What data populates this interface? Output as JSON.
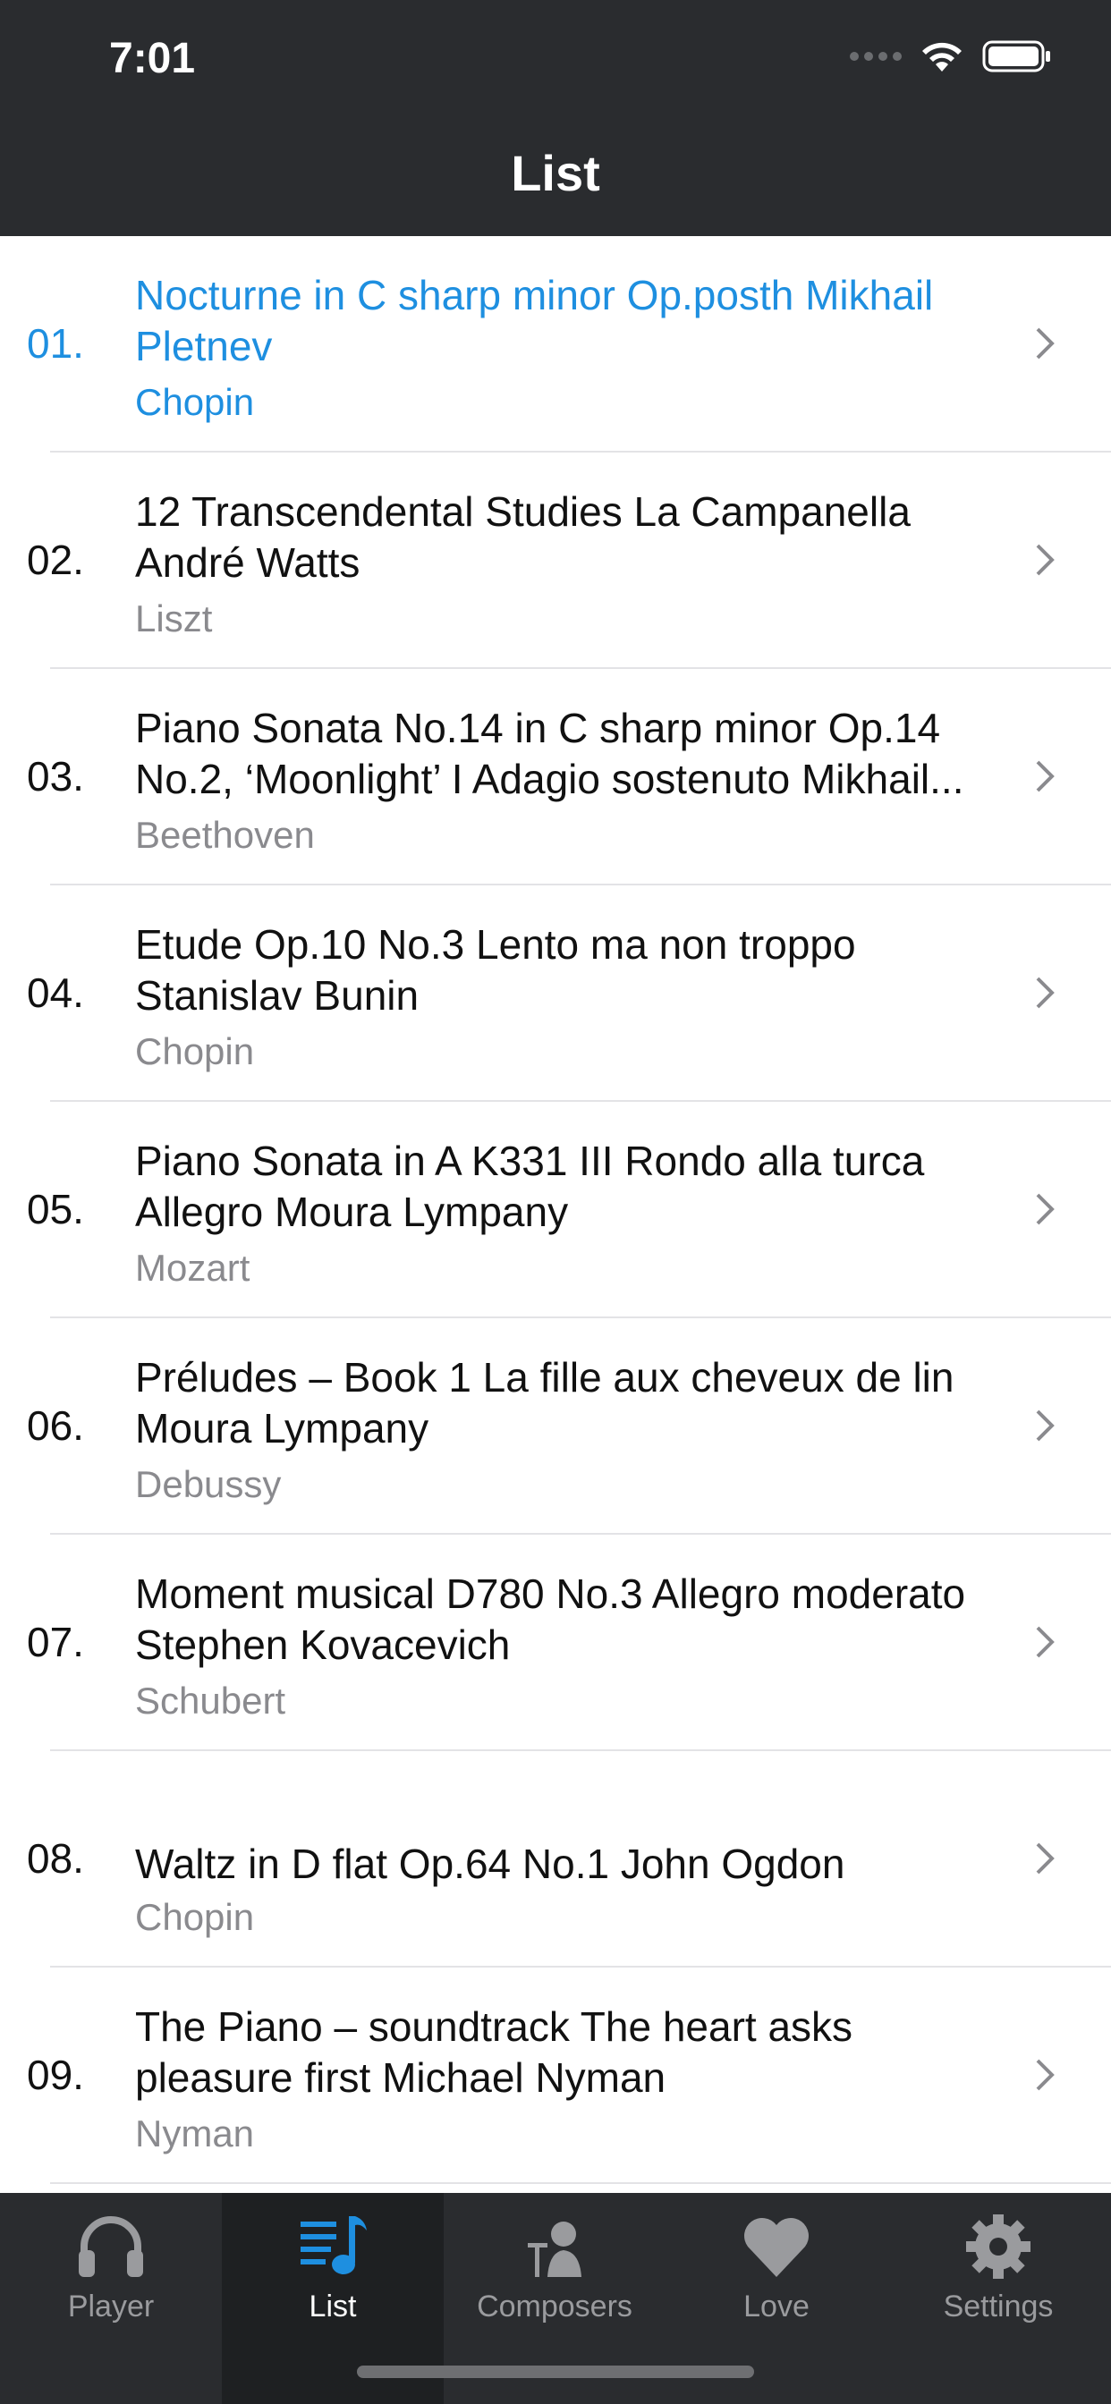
{
  "status": {
    "time": "7:01"
  },
  "header": {
    "title": "List"
  },
  "tracks": [
    {
      "number": "01.",
      "title": "Nocturne in C sharp minor Op.posth Mikhail Pletnev",
      "composer": "Chopin"
    },
    {
      "number": "02.",
      "title": "12 Transcendental Studies La Campanella André Watts",
      "composer": "Liszt"
    },
    {
      "number": "03.",
      "title": "Piano Sonata No.14 in C sharp minor Op.14 No.2, ‘Moonlight’ I Adagio sostenuto Mikhail...",
      "composer": "Beethoven"
    },
    {
      "number": "04.",
      "title": "Etude Op.10 No.3 Lento ma non troppo Stanislav Bunin",
      "composer": "Chopin"
    },
    {
      "number": "05.",
      "title": "Piano Sonata in A K331 III Rondo alla turca Allegro Moura Lympany",
      "composer": "Mozart"
    },
    {
      "number": "06.",
      "title": "Préludes – Book 1 La fille aux cheveux de lin Moura Lympany",
      "composer": "Debussy"
    },
    {
      "number": "07.",
      "title": "Moment musical D780 No.3 Allegro moderato Stephen Kovacevich",
      "composer": "Schubert"
    },
    {
      "number": "08.",
      "title": "Waltz in D flat Op.64 No.1 John Ogdon",
      "composer": "Chopin"
    },
    {
      "number": "09.",
      "title": "The Piano – soundtrack The heart asks pleasure first Michael Nyman",
      "composer": "Nyman"
    }
  ],
  "tabs": [
    {
      "label": "Player",
      "icon": "headphones-icon"
    },
    {
      "label": "List",
      "icon": "music-list-icon"
    },
    {
      "label": "Composers",
      "icon": "composer-bust-icon"
    },
    {
      "label": "Love",
      "icon": "heart-icon"
    },
    {
      "label": "Settings",
      "icon": "gear-icon"
    }
  ],
  "colors": {
    "accent": "#1e8fe0",
    "bar": "#2a2c2f",
    "tab_inactive": "#9a9b9e"
  }
}
